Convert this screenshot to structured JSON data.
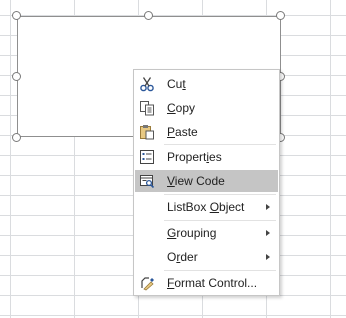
{
  "context_menu": {
    "items": [
      {
        "label": "Cut",
        "underline_index": 2,
        "icon": "scissors-icon"
      },
      {
        "label": "Copy",
        "underline_index": 0,
        "icon": "copy-icon"
      },
      {
        "label": "Paste",
        "underline_index": 0,
        "icon": "paste-icon"
      },
      {
        "label": "Properties",
        "underline_index": 7,
        "icon": "properties-icon"
      },
      {
        "label": "View Code",
        "underline_index": 0,
        "icon": "view-code-icon",
        "highlighted": true
      },
      {
        "label": "ListBox Object",
        "underline_index": 8,
        "submenu": true
      },
      {
        "label": "Grouping",
        "underline_index": 0,
        "submenu": true
      },
      {
        "label": "Order",
        "underline_index": 1,
        "submenu": true
      },
      {
        "label": "Format Control...",
        "underline_index": 0,
        "icon": "format-control-icon"
      }
    ]
  },
  "colors": {
    "highlight": "#c5c5c5",
    "gridline": "#dadcdf",
    "accent_blue": "#2b579a"
  }
}
